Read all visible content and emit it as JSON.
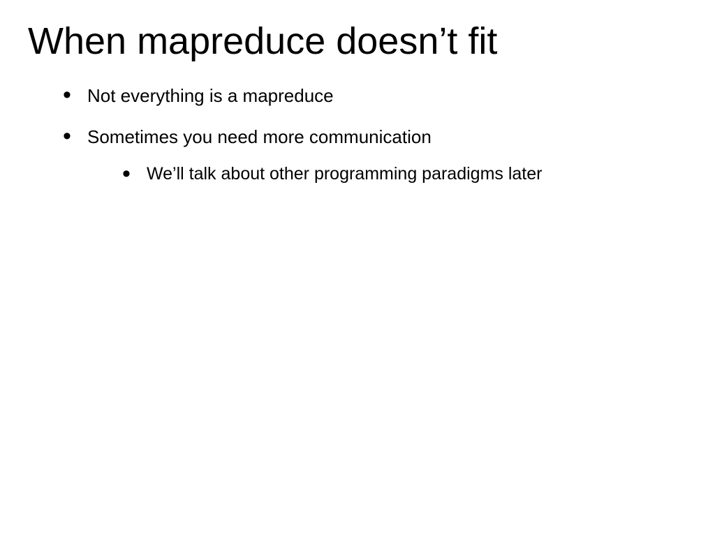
{
  "slide": {
    "title": "When mapreduce doesn’t fit",
    "bullets": [
      {
        "text": "Not everything is a mapreduce",
        "subbullets": []
      },
      {
        "text": "Sometimes you need more communication",
        "subbullets": [
          {
            "text": "We’ll talk about other programming paradigms later"
          }
        ]
      }
    ]
  }
}
